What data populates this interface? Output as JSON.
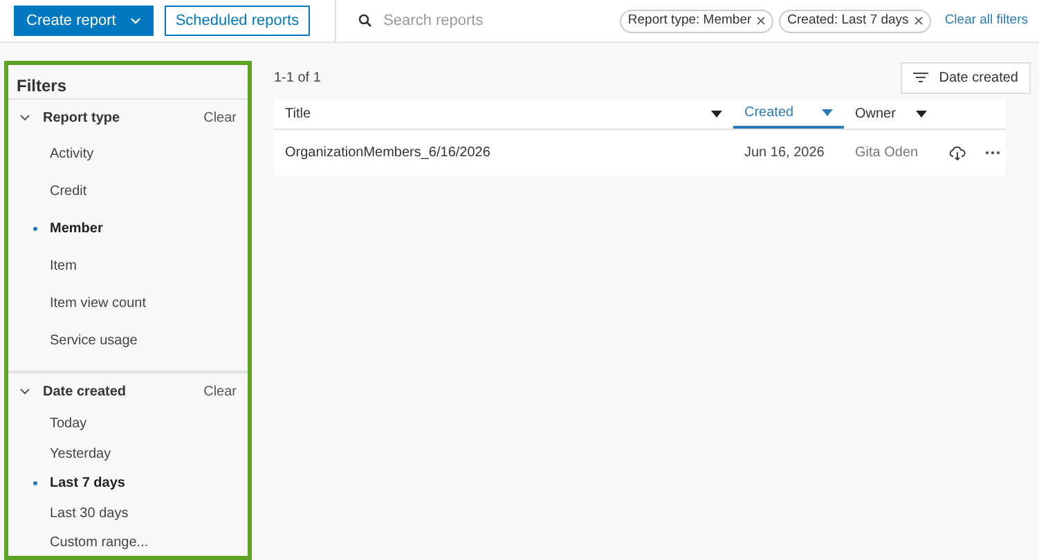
{
  "toolbar": {
    "create_button": "Create report",
    "scheduled_button": "Scheduled reports",
    "search": {
      "placeholder": "Search reports"
    },
    "chips": [
      {
        "label": "Report type: Member"
      },
      {
        "label": "Created: Last 7 days"
      }
    ],
    "clear_all": "Clear all filters"
  },
  "filters": {
    "title": "Filters",
    "sections": [
      {
        "title": "Report type",
        "expanded": true,
        "clear": "Clear",
        "items": [
          {
            "label": "Activity",
            "selected": false
          },
          {
            "label": "Credit",
            "selected": false
          },
          {
            "label": "Member",
            "selected": true
          },
          {
            "label": "Item",
            "selected": false
          },
          {
            "label": "Item view count",
            "selected": false
          },
          {
            "label": "Service usage",
            "selected": false
          }
        ]
      },
      {
        "title": "Date created",
        "expanded": true,
        "clear": "Clear",
        "items": [
          {
            "label": "Today",
            "selected": false
          },
          {
            "label": "Yesterday",
            "selected": false
          },
          {
            "label": "Last 7 days",
            "selected": true
          },
          {
            "label": "Last 30 days",
            "selected": false
          },
          {
            "label": "Custom range...",
            "selected": false
          }
        ]
      }
    ]
  },
  "results": {
    "count": "1-1 of 1",
    "sort_button": "Date created"
  },
  "table": {
    "columns": [
      {
        "label": "Title",
        "selected": false
      },
      {
        "label": "Created",
        "selected": true
      },
      {
        "label": "Owner",
        "selected": false
      }
    ],
    "rows": [
      {
        "title": "OrganizationMembers_6/16/2026",
        "created": "Jun 16, 2026",
        "owner": "Gita Oden"
      }
    ]
  }
}
